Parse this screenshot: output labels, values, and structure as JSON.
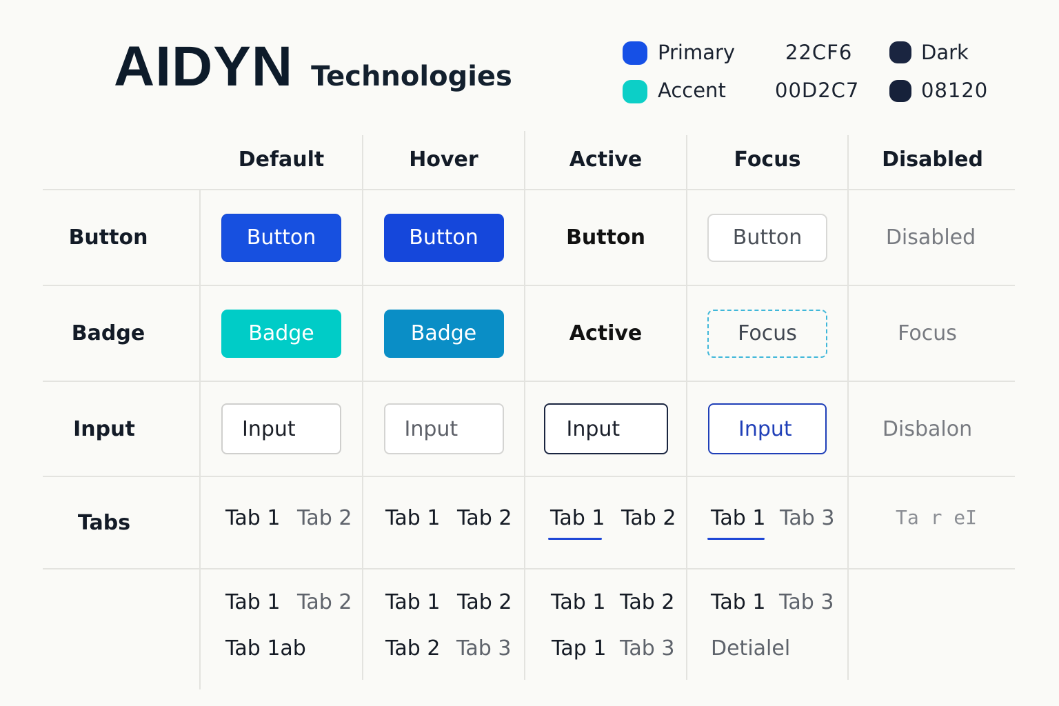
{
  "brand": {
    "name": "AIDYN",
    "subtitle": "Technologies"
  },
  "legend": [
    {
      "label": "Primary",
      "color": "#1650e6"
    },
    {
      "label": "Accent",
      "color": "#0ccfc7"
    },
    {
      "label": "22CF6"
    },
    {
      "label": "00D2C7"
    },
    {
      "label": "Dark",
      "color": "#1a2540"
    },
    {
      "label": "08120",
      "color": "#16213a"
    }
  ],
  "columns": [
    "Default",
    "Hover",
    "Active",
    "Focus",
    "Disabled"
  ],
  "rows": [
    "Button",
    "Badge",
    "Input",
    "Tabs"
  ],
  "button": {
    "default": "Button",
    "hover": "Button",
    "active": "Button",
    "focus": "Button",
    "disabled": "Disabled"
  },
  "badge": {
    "default": "Badge",
    "hover": "Badge",
    "active": "Active",
    "focus": "Focus",
    "disabled": "Focus"
  },
  "input": {
    "default": "Input",
    "hover": "Input",
    "active": "Input",
    "focus": "Input",
    "disabled": "Disbalon"
  },
  "tabs": {
    "default": [
      "Tab 1",
      "Tab 2"
    ],
    "hover": [
      "Tab 1",
      "Tab 2"
    ],
    "active": [
      "Tab 1",
      "Tab 2"
    ],
    "focus": [
      "Tab 1",
      "Tab 3"
    ],
    "disabled": "Ta r eI"
  },
  "extra": {
    "default": [
      "Tab 1",
      "Tab 2",
      "Tab 1ab"
    ],
    "hover": [
      "Tab 1",
      "Tab 2",
      "Tab 2",
      "Tab 3"
    ],
    "active": [
      "Tab 1",
      "Tab 2",
      "Tap 1",
      "Tab 3"
    ],
    "focus": [
      "Tab 1",
      "Tab 3",
      "Detialel"
    ]
  }
}
